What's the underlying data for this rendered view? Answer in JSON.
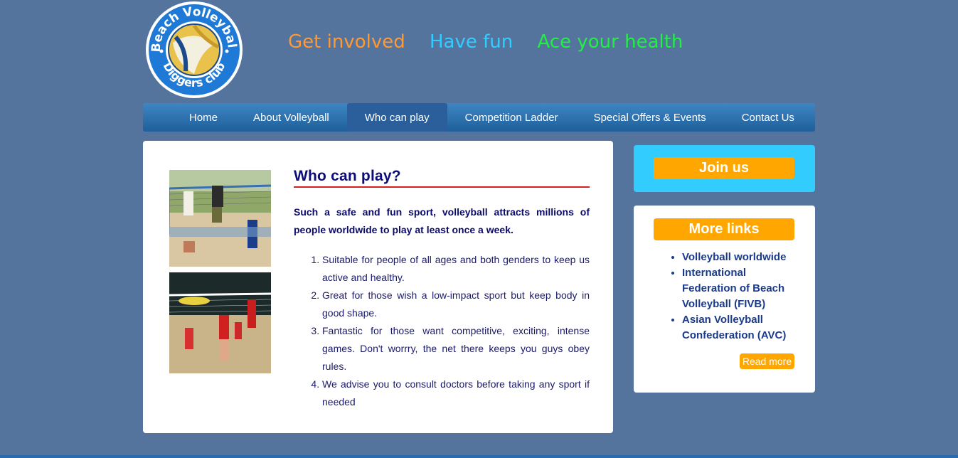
{
  "logo": {
    "text_top": "Beach Volleyball",
    "text_bottom": "Diggers club"
  },
  "taglines": [
    {
      "text": "Get involved",
      "color": "#ff9933"
    },
    {
      "text": "Have fun",
      "color": "#33ccff"
    },
    {
      "text": "Ace your health",
      "color": "#22ee44"
    }
  ],
  "nav": {
    "items": [
      {
        "label": "Home"
      },
      {
        "label": "About Volleyball"
      },
      {
        "label": "Who can play",
        "active": true
      },
      {
        "label": "Competition Ladder"
      },
      {
        "label": "Special Offers & Events"
      },
      {
        "label": "Contact Us"
      }
    ]
  },
  "main": {
    "title": "Who can play?",
    "intro": "Such a safe and fun sport, volleyball attracts millions of people worldwide to play at least once a week.",
    "list": [
      "Suitable for people of all ages and both genders to keep us active and healthy.",
      "Great for those wish a low-impact sport but keep body in good shape.",
      "Fantastic for those want competitive, exciting, intense games. Don't worrry, the net there keeps you guys obey rules.",
      "We advise you to consult doctors before taking any sport if needed"
    ]
  },
  "sidebar": {
    "join_label": "Join us",
    "more_links_label": "More links",
    "links": [
      "Volleyball worldwide",
      "International Federation of Beach Volleyball (FIVB)",
      "Asian Volleyball Confederation (AVC)"
    ],
    "read_more_label": "Read more"
  },
  "colors": {
    "background": "#54749e",
    "accent_orange": "#ffa600",
    "accent_cyan": "#33ccff",
    "title_blue": "#0b0b7a"
  }
}
